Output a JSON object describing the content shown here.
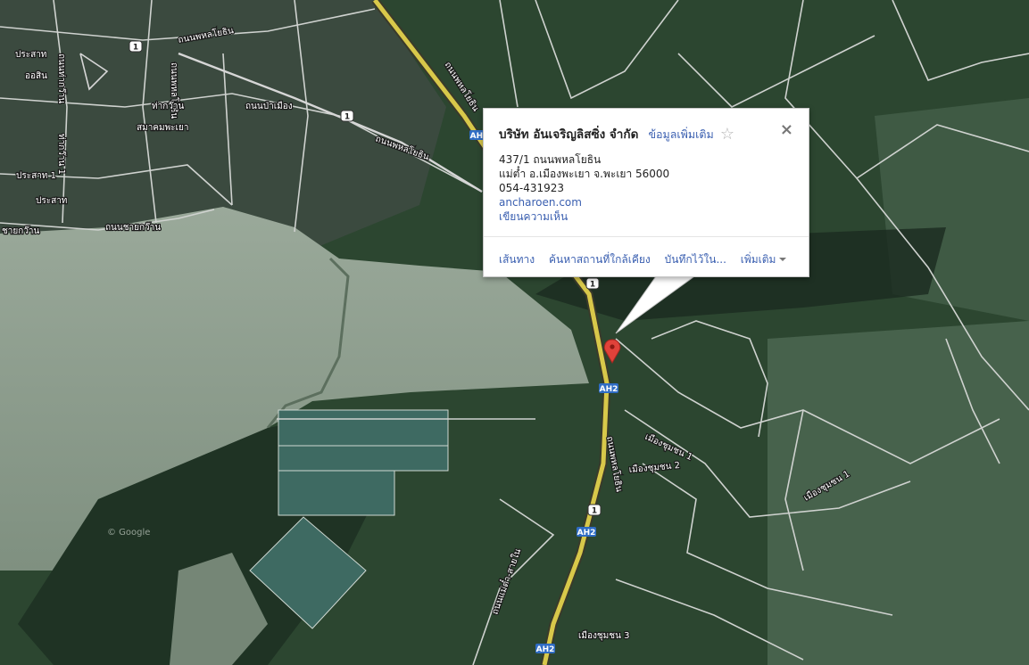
{
  "info_window": {
    "title": "บริษัท อันเจริญลิสซิ่ง จำกัด",
    "more_info_link": "ข้อมูลเพิ่มเติม",
    "star_icon": "☆",
    "close_icon": "×",
    "address_line1": "437/1 ถนนพหลโยธิน",
    "address_line2": "แม่ต๋ำ อ.เมืองพะเยา จ.พะเยา 56000",
    "phone": "054-431923",
    "website": "ancharoen.com",
    "write_review": "เขียนความเห็น",
    "actions": {
      "directions": "เส้นทาง",
      "search_nearby": "ค้นหาสถานที่ใกล้เคียง",
      "save_to": "บันทึกไว้ใน...",
      "more": "เพิ่มเติม"
    }
  },
  "map_labels": {
    "phahonyothin_north": "ถนนพหลโยธิน",
    "phahonyothin_mid": "ถนนพหลโยธิน",
    "phahonyothin_south": "ถนนพหลโยธิน",
    "phahonyothin_west": "ถนนพหลโยธิน",
    "phahonyothin_vert": "ถนนพหลโยธิน",
    "thanon_chaikwan": "ถนนชายกว๊าน",
    "chaikwan": "ชายกว๊าน",
    "thakwan": "ท่ากว๊าน",
    "thanon_pramuang": "ถนนป่าเมือง",
    "samakhom": "สมาคมพะเยา",
    "prasat1": "ประสาท 1",
    "prasat": "ประสาท",
    "prasat_top": "ประสาท",
    "orsin": "ออสิน",
    "thakwan_road": "ถนนท่ากว๊าน",
    "thakwan_1": "ท่ากว๊าน 1",
    "muang_chumchon_1": "เมืองชุมชน 1",
    "muang_chumchon_2": "เมืองชุมชน 2",
    "muang_chumchon_1b": "เมืองชุมชน 1",
    "muang_chumchon_3": "เมืองชุมชน 3",
    "mae_tam": "ถนนแม่ต๋ำ-สายใน",
    "watermark": "© Google"
  },
  "route_shields": [
    "1",
    "1",
    "1",
    "1"
  ],
  "ah_shields": [
    "AH2",
    "AH2",
    "AH2",
    "AH2"
  ],
  "marker": {
    "icon": "map-pin-icon",
    "color": "#e0423a"
  },
  "colors": {
    "link": "#3a5fb0",
    "road": "#d6d6d6",
    "highway": "#d8c84a"
  }
}
